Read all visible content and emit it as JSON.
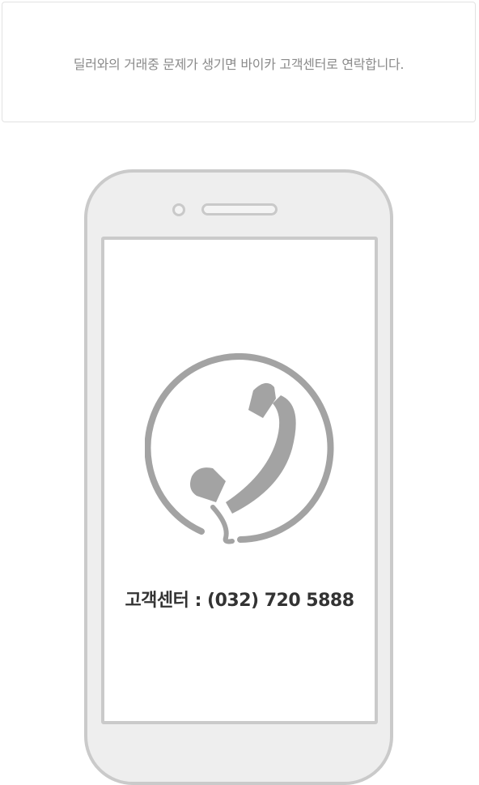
{
  "notice": {
    "text": "딜러와의 거래중 문제가 생기면 바이카 고객센터로 연락합니다."
  },
  "support": {
    "label": "고객센터",
    "separator": " : ",
    "phone": "(032) 720 5888"
  },
  "icons": {
    "contact": "phone-handset-icon"
  },
  "colors": {
    "icon_gray": "#a3a3a3",
    "frame_gray": "#cacaca",
    "phone_body": "#eeeeee",
    "text_dark": "#333333",
    "text_muted": "#8a8a8a"
  }
}
